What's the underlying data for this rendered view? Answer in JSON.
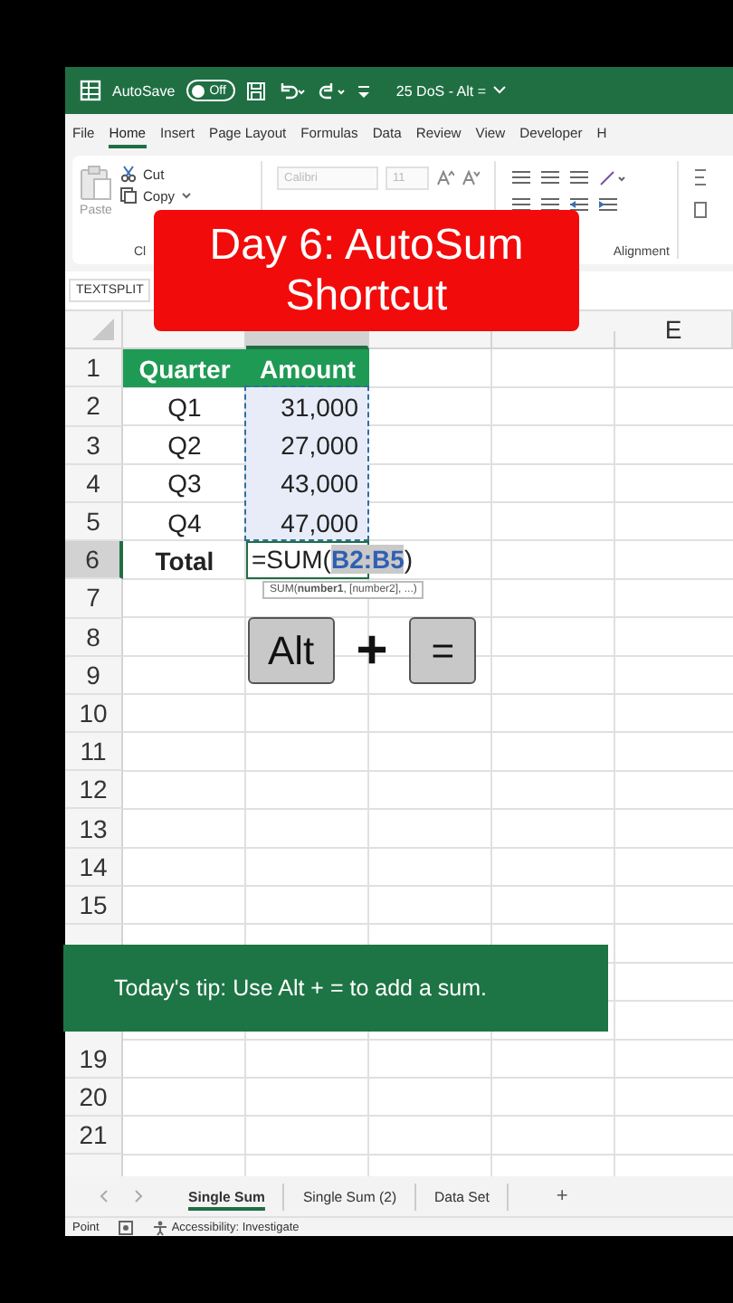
{
  "window": {
    "autosave_label": "AutoSave",
    "autosave": {
      "label": "Off",
      "on": false
    },
    "title": "25 DoS - Alt ="
  },
  "menu_tabs": [
    {
      "label": "File",
      "selected": false
    },
    {
      "label": "Home",
      "selected": true
    },
    {
      "label": "Insert",
      "selected": false
    },
    {
      "label": "Page Layout",
      "selected": false
    },
    {
      "label": "Formulas",
      "selected": false
    },
    {
      "label": "Data",
      "selected": false
    },
    {
      "label": "Review",
      "selected": false
    },
    {
      "label": "View",
      "selected": false
    },
    {
      "label": "Developer",
      "selected": false
    },
    {
      "label": "H",
      "selected": false
    }
  ],
  "ribbon": {
    "paste": "Paste",
    "cut": "Cut",
    "copy": "Copy",
    "clipboard_group": "Cl",
    "font": "Calibri",
    "font_size": "11",
    "alignment_group": "Alignment"
  },
  "name_box": "TEXTSPLIT",
  "columns": [
    {
      "selected": false
    },
    {
      "selected": true
    },
    {
      "selected": false
    },
    {
      "selected": false
    },
    {
      "label": "E",
      "selected": false
    }
  ],
  "rows": [
    {
      "label": "1",
      "selected": false,
      "cells": [
        {
          "kind": "header",
          "text": "Quarter"
        },
        {
          "kind": "header",
          "text": "Amount"
        }
      ]
    },
    {
      "label": "2",
      "selected": false,
      "cells": [
        {
          "kind": "text",
          "text": "Q1"
        },
        {
          "kind": "ref",
          "text": "31,000"
        }
      ]
    },
    {
      "label": "3",
      "selected": false,
      "cells": [
        {
          "kind": "text",
          "text": "Q2"
        },
        {
          "kind": "ref",
          "text": "27,000"
        }
      ]
    },
    {
      "label": "4",
      "selected": false,
      "cells": [
        {
          "kind": "text",
          "text": "Q3"
        },
        {
          "kind": "ref",
          "text": "43,000"
        }
      ]
    },
    {
      "label": "5",
      "selected": false,
      "cells": [
        {
          "kind": "text",
          "text": "Q4"
        },
        {
          "kind": "ref",
          "text": "47,000"
        }
      ]
    },
    {
      "label": "6",
      "selected": true,
      "cells": [
        {
          "kind": "total",
          "text": "Total"
        },
        {
          "kind": "formula",
          "parts": [
            {
              "kind": "plain",
              "text": "=SUM("
            },
            {
              "kind": "ref",
              "text": "B2:B5"
            },
            {
              "kind": "plain",
              "text": ")"
            }
          ]
        }
      ]
    },
    {
      "label": "7",
      "selected": false
    },
    {
      "label": "8",
      "selected": false
    },
    {
      "label": "9",
      "selected": false
    },
    {
      "label": "10",
      "selected": false
    },
    {
      "label": "11",
      "selected": false
    },
    {
      "label": "12",
      "selected": false
    },
    {
      "label": "13",
      "selected": false
    },
    {
      "label": "14",
      "selected": false
    },
    {
      "label": "15",
      "selected": false
    },
    {},
    {},
    {},
    {
      "label": "19",
      "selected": false
    },
    {
      "label": "20",
      "selected": false
    },
    {
      "label": "21",
      "selected": false
    },
    {}
  ],
  "formula_tooltip": "SUM(**number1**, [number2], ...)",
  "title_card": "Day 6: AutoSum Shortcut",
  "keys": [
    {
      "kind": "key",
      "text": "Alt"
    },
    {
      "kind": "plus",
      "text": "+"
    },
    {
      "kind": "key",
      "text": "="
    }
  ],
  "tip": "Today's tip: Use Alt + = to add a sum.",
  "sheet_tabs": [
    {
      "label": "Single Sum",
      "selected": true
    },
    {
      "label": "Single Sum (2)",
      "selected": false
    },
    {
      "label": "Data Set",
      "selected": false
    }
  ],
  "add_sheet": "+",
  "status_bar": {
    "mode": "Point",
    "accessibility": "Accessibility: Investigate"
  }
}
